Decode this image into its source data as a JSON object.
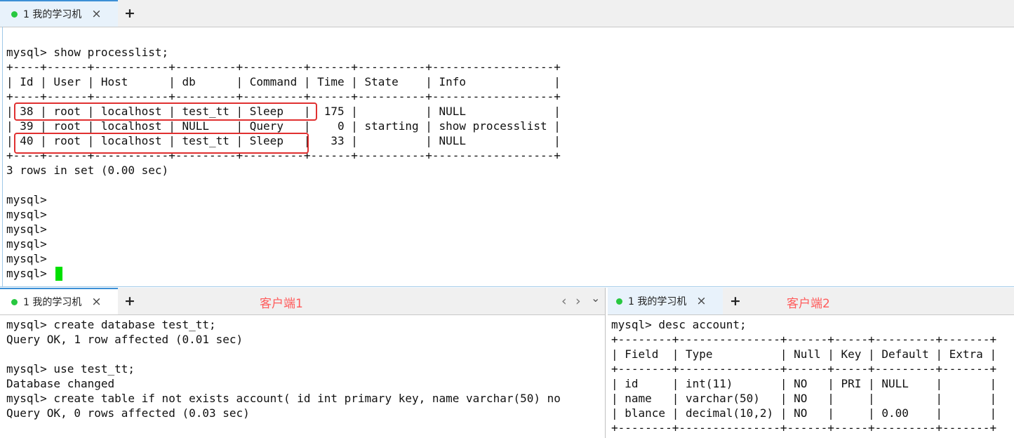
{
  "top_pane": {
    "tab_label": "1 我的学习机",
    "tab_close": "×",
    "add_tab": "+",
    "terminal_lines": [
      "mysql> show processlist;",
      "+----+------+-----------+---------+---------+------+----------+------------------+",
      "| Id | User | Host      | db      | Command | Time | State    | Info             |",
      "+----+------+-----------+---------+---------+------+----------+------------------+",
      "| 38 | root | localhost | test_tt | Sleep   |  175 |          | NULL             |",
      "| 39 | root | localhost | NULL    | Query   |    0 | starting | show processlist |",
      "| 40 | root | localhost | test_tt | Sleep   |   33 |          | NULL             |",
      "+----+------+-----------+---------+---------+------+----------+------------------+",
      "3 rows in set (0.00 sec)",
      "",
      "mysql>",
      "mysql>",
      "mysql>",
      "mysql>",
      "mysql>",
      "mysql> "
    ]
  },
  "left_pane": {
    "tab_label": "1 我的学习机",
    "tab_close": "×",
    "add_tab": "+",
    "annotation": "客户端1",
    "nav_prev": "‹",
    "nav_next": "›",
    "menu": "⌄",
    "terminal_lines": [
      "mysql> create database test_tt;",
      "Query OK, 1 row affected (0.01 sec)",
      "",
      "mysql> use test_tt;",
      "Database changed",
      "mysql> create table if not exists account( id int primary key, name varchar(50) no",
      "Query OK, 0 rows affected (0.03 sec)"
    ]
  },
  "right_pane": {
    "tab_label": "1 我的学习机",
    "tab_close": "×",
    "add_tab": "+",
    "annotation": "客户端2",
    "terminal_lines": [
      "mysql> desc account;",
      "+--------+---------------+------+-----+---------+-------+",
      "| Field  | Type          | Null | Key | Default | Extra |",
      "+--------+---------------+------+-----+---------+-------+",
      "| id     | int(11)       | NO   | PRI | NULL    |       |",
      "| name   | varchar(50)   | NO   |     |         |       |",
      "| blance | decimal(10,2) | NO   |     | 0.00    |       |",
      "+--------+---------------+------+-----+---------+-------+"
    ]
  },
  "colors": {
    "tab_active_bg": "#e8f2fb",
    "tab_bar_bg": "#f0f0f0",
    "status_dot": "#28c840",
    "highlight_box": "#e03030",
    "annotation_text": "#ff5a5a",
    "cursor": "#00e000"
  }
}
